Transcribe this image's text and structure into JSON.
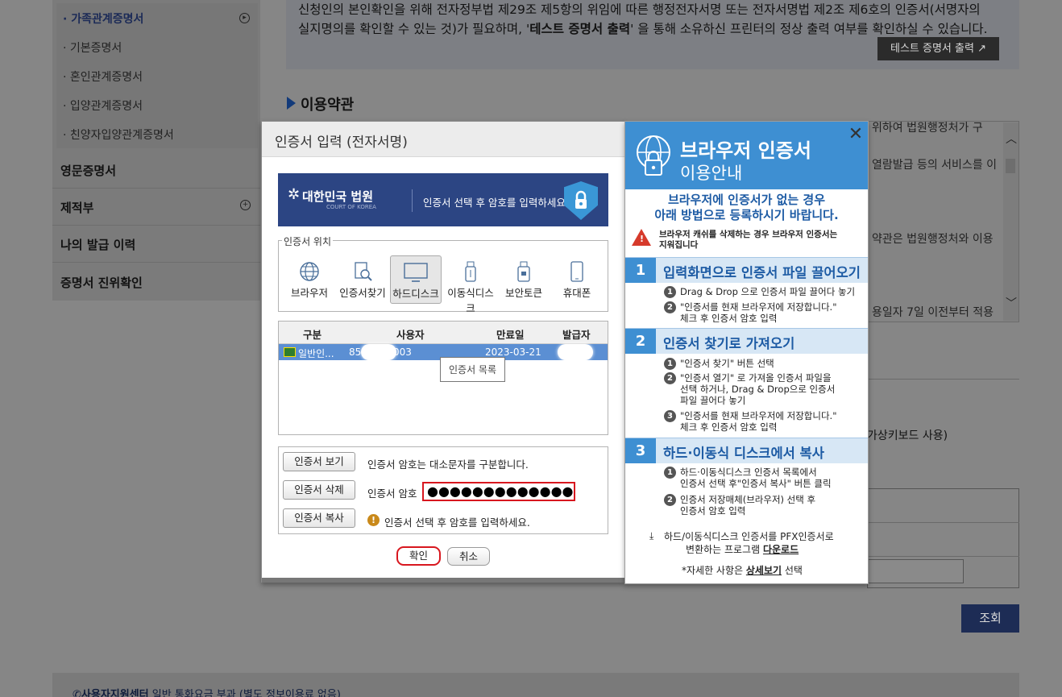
{
  "sidebar": {
    "sub_items": [
      "가족관계증명서",
      "기본증명서",
      "혼인관계증명서",
      "입양관계증명서",
      "친양자입양관계증명서"
    ],
    "main_items": [
      "영문증명서",
      "제적부",
      "나의 발급 이력",
      "증명서 진위확인"
    ]
  },
  "notice": {
    "line1": "신청인의 본인확인을 위해 전자정부법 제29조 제5항의 위임에 따른 행정전자서명 또는 전자서명법 제2조 제6호의 인증서(서명자의",
    "line2_a": "실지명의를 확인할 수 있는 것)가 필요하며, '",
    "line2_b": "테스트 증명서 출력",
    "line2_c": "' 을 통해 소유하신 프린터의 정상 출력 여부를 확인하실 수 있습니다.",
    "test_print_button": "테스트 증명서 출력"
  },
  "terms": {
    "title": "이용약관",
    "lines": [
      "위하여 법원행정처가 구",
      "열람발급 등의 서비스를 이",
      "약관은 법원행정처와 이용",
      "용일자 7일 이전부터 적용"
    ]
  },
  "background": {
    "keyboard_fragment": "가상키보드 사용)",
    "search_button": "조회",
    "footer_center": "사용자지원센터",
    "footer_text": "일반 통화요금 부과 (별도 정보이용료 없음)"
  },
  "modal": {
    "title": "인증서 입력 (전자서명)",
    "banner_org": "대한민국 법원",
    "banner_org_en": "COURT OF KOREA",
    "banner_msg": "인증서 선택 후 암호를 입력하세요.",
    "location_legend": "인증서 위치",
    "locations": [
      "브라우저",
      "인증서찾기",
      "하드디스크",
      "이동식디스크",
      "보안토큰",
      "휴대폰"
    ],
    "selected_location": "하드디스크",
    "table_headers": [
      "구분",
      "사용자",
      "만료일",
      "발급자"
    ],
    "cert_row": {
      "type": "일반인...",
      "user_a": "85",
      "user_b": "003",
      "expiry": "2023-03-21",
      "issuer": ""
    },
    "list_tooltip": "인증서 목록",
    "view_button": "인증서 보기",
    "delete_button": "인증서 삭제",
    "copy_button": "인증서 복사",
    "case_note": "인증서 암호는 대소문자를 구분합니다.",
    "password_label": "인증서 암호",
    "password_value": "●●●●●●●●●●●●●",
    "hint": "인증서 선택 후 암호를 입력하세요.",
    "ok_button": "확인",
    "cancel_button": "취소"
  },
  "guide": {
    "title1": "브라우저 인증서",
    "title2": "이용안내",
    "intro1": "브라우저에 인증서가 없는 경우",
    "intro2": "아래 방법으로 등록하시기 바랍니다.",
    "warn1": "브라우저 캐쉬를 삭제하는 경우 브라우저 인증서는",
    "warn2": "지워집니다",
    "step1_num": "1",
    "step1_title": "입력화면으로 인증서 파일 끌어오기",
    "step1_lines": [
      "Drag & Drop 으로 인증서 파일 끌어다 놓기",
      "\"인증서를 현재 브라우저에 저장합니다.\"",
      "체크 후 인증서 암호 입력"
    ],
    "step2_num": "2",
    "step2_title": "인증서 찾기로 가져오기",
    "step2_lines": [
      "\"인증서 찾기\" 버튼 선택",
      "\"인증서 열기\" 로 가져올 인증서 파일을",
      "선택 하거나, Drag & Drop으로 인증서",
      "파일 끌어다 놓기",
      "\"인증서를 현재 브라우저에 저장합니다.\"",
      "체크 후 인증서 암호 입력"
    ],
    "step3_num": "3",
    "step3_title": "하드·이동식 디스크에서 복사",
    "step3_lines": [
      "하드·이동식디스크 인증서 목록에서",
      "인증서 선택 후\"인증서 복사\" 버튼 클릭",
      "인증서 저장매체(브라우저) 선택 후",
      "인증서 암호 입력"
    ],
    "pfx1": "하드/이동식디스크 인증서를 PFX인증서로",
    "pfx2_a": "변환하는 프로그램 ",
    "pfx2_link": "다운로드",
    "detail_a": "*자세한 사항은 ",
    "detail_link": "상세보기",
    "detail_b": " 선택"
  }
}
